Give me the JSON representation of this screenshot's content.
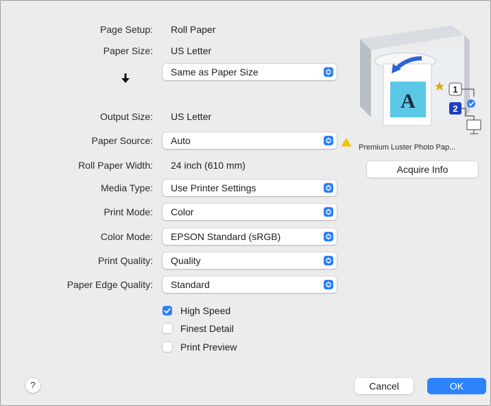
{
  "fields": {
    "page_setup": {
      "label": "Page Setup:",
      "value": "Roll Paper"
    },
    "paper_size": {
      "label": "Paper Size:",
      "value": "US Letter"
    },
    "reduce_enlarge": {
      "value": "Same as Paper Size",
      "icon": "down-arrow-icon"
    },
    "output_size": {
      "label": "Output Size:",
      "value": "US Letter"
    },
    "paper_source": {
      "label": "Paper Source:",
      "value": "Auto"
    },
    "roll_paper_width": {
      "label": "Roll Paper Width:",
      "value": "24 inch (610 mm)"
    },
    "media_type": {
      "label": "Media Type:",
      "value": "Use Printer Settings"
    },
    "print_mode": {
      "label": "Print Mode:",
      "value": "Color"
    },
    "color_mode": {
      "label": "Color Mode:",
      "value": "EPSON Standard (sRGB)"
    },
    "print_quality": {
      "label": "Print Quality:",
      "value": "Quality"
    },
    "paper_edge_quality": {
      "label": "Paper Edge Quality:",
      "value": "Standard"
    }
  },
  "checkboxes": [
    {
      "label": "High Speed",
      "checked": true
    },
    {
      "label": "Finest Detail",
      "checked": false
    },
    {
      "label": "Print Preview",
      "checked": false
    }
  ],
  "preview": {
    "media_name": "Premium Luster Photo Pap...",
    "acquire_info_label": "Acquire Info",
    "step_1": "1",
    "step_2": "2",
    "sheet_letter": "A",
    "warning_icon": "warning-triangle-icon"
  },
  "footer": {
    "help_label": "?",
    "cancel_label": "Cancel",
    "ok_label": "OK"
  },
  "colors": {
    "accent": "#2d7ff9",
    "warning": "#f2c200",
    "background": "#ececec"
  }
}
